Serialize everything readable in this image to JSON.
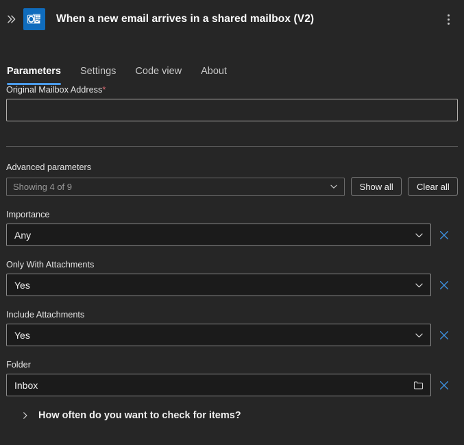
{
  "header": {
    "expand_icon": "double-chevron-right-icon",
    "app_icon": "outlook-icon",
    "title": "When a new email arrives in a shared mailbox (V2)",
    "overflow_icon": "more-vertical-icon"
  },
  "tabs": [
    {
      "label": "Parameters",
      "active": true
    },
    {
      "label": "Settings",
      "active": false
    },
    {
      "label": "Code view",
      "active": false
    },
    {
      "label": "About",
      "active": false
    }
  ],
  "required_field": {
    "label": "Original Mailbox Address",
    "required_marker": "*",
    "value": "",
    "placeholder": ""
  },
  "advanced": {
    "section_label": "Advanced parameters",
    "select_text": "Showing 4 of 9",
    "chevron_icon": "chevron-down-icon",
    "show_all_label": "Show all",
    "clear_all_label": "Clear all"
  },
  "parameters": [
    {
      "label": "Importance",
      "value": "Any",
      "trailing_icon": "chevron-down-icon",
      "clear_icon": "close-icon"
    },
    {
      "label": "Only With Attachments",
      "value": "Yes",
      "trailing_icon": "chevron-down-icon",
      "clear_icon": "close-icon"
    },
    {
      "label": "Include Attachments",
      "value": "Yes",
      "trailing_icon": "chevron-down-icon",
      "clear_icon": "close-icon"
    },
    {
      "label": "Folder",
      "value": "Inbox",
      "trailing_icon": "folder-icon",
      "clear_icon": "close-icon"
    }
  ],
  "collapsible": {
    "chevron_icon": "chevron-right-icon",
    "title": "How often do you want to check for items?"
  },
  "colors": {
    "page_background": "#262626",
    "field_background": "#1b1b1b",
    "accent_blue": "#4a9ae8",
    "clear_blue": "#3d91e0",
    "brand_blue": "#0F6CBD",
    "required_red": "#e06c75"
  }
}
